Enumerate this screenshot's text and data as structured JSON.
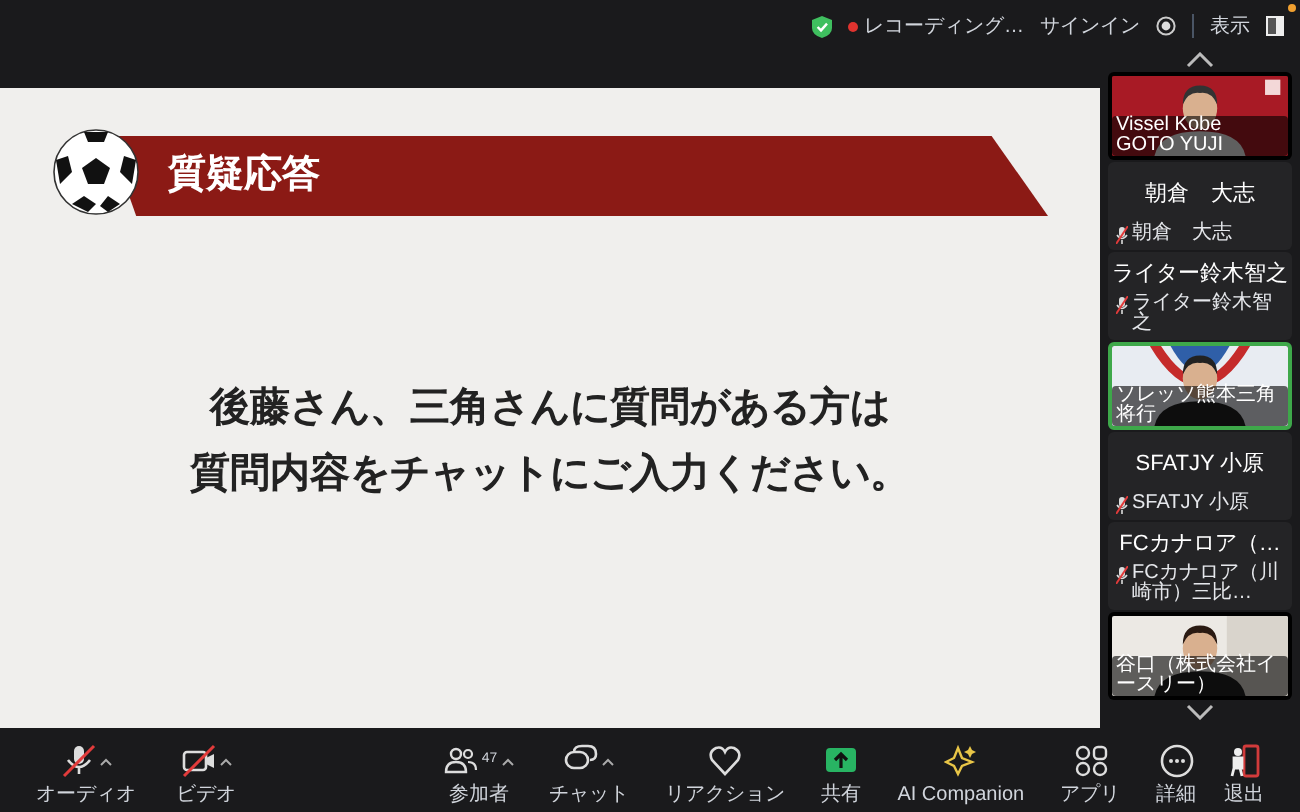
{
  "top_bar": {
    "recording": "レコーディング…",
    "sign_in": "サインイン",
    "view": "表示"
  },
  "slide": {
    "title": "質疑応答",
    "lines": [
      "後藤さん、三角さんに質問がある方は",
      "質問内容をチャットにご入力ください。"
    ]
  },
  "participants": [
    {
      "kind": "video",
      "label": "Vissel Kobe GOTO YUJI",
      "active": false,
      "muted": false
    },
    {
      "kind": "name",
      "name": "朝倉　大志",
      "label": "朝倉　大志",
      "active": false,
      "muted": true
    },
    {
      "kind": "name",
      "name": "ライター鈴木智之",
      "label": "ライター鈴木智之",
      "active": false,
      "muted": true
    },
    {
      "kind": "video",
      "label": "ソレッソ熊本三角将行",
      "active": true,
      "muted": false
    },
    {
      "kind": "name",
      "name": "SFATJY 小原",
      "label": "SFATJY 小原",
      "active": false,
      "muted": true
    },
    {
      "kind": "name",
      "name": "FCカナロア（…",
      "label": "FCカナロア（川崎市）三比…",
      "active": false,
      "muted": true
    },
    {
      "kind": "video",
      "label": "谷口（株式会社イースリー）",
      "active": false,
      "muted": false
    }
  ],
  "toolbar": {
    "left": [
      {
        "kind": "audio",
        "label": "オーディオ",
        "muted": true,
        "caret": true
      },
      {
        "kind": "video",
        "label": "ビデオ",
        "muted": true,
        "caret": true
      }
    ],
    "center": [
      {
        "kind": "participants",
        "label": "参加者",
        "count": "47",
        "caret": true
      },
      {
        "kind": "chat",
        "label": "チャット",
        "caret": true
      },
      {
        "kind": "reaction",
        "label": "リアクション",
        "caret": false
      },
      {
        "kind": "share",
        "label": "共有",
        "caret": false
      },
      {
        "kind": "ai",
        "label": "AI Companion",
        "caret": false
      },
      {
        "kind": "apps",
        "label": "アプリ",
        "caret": false
      },
      {
        "kind": "more",
        "label": "詳細",
        "caret": false
      }
    ],
    "right": [
      {
        "kind": "leave",
        "label": "退出",
        "caret": false
      }
    ]
  }
}
